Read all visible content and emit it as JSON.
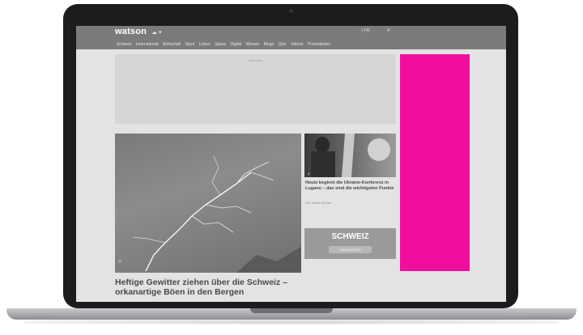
{
  "header": {
    "logo": "watson",
    "weather_icon": "cloud-sun-icon",
    "right_text": "·  |  FR",
    "search_icon": "search-icon"
  },
  "nav": {
    "items": [
      "Schweiz",
      "International",
      "Wirtschaft",
      "Sport",
      "Leben",
      "Spass",
      "Digital",
      "Wissen",
      "Blogs",
      "Quiz",
      "Videos",
      "Promotionen"
    ]
  },
  "ad": {
    "label": "Werbung"
  },
  "main_article": {
    "title": "Heftige Gewitter ziehen über die Schweiz – orkanartige Böen in den Bergen"
  },
  "side_article": {
    "count": "4",
    "title": "Heute beginnt die Ukraine-Konferenz in Lugano – das sind die wichtigsten Punkte",
    "author": "Von Stefan Bühler"
  },
  "schweiz_box": {
    "label": "SCHWEIZ",
    "button": "ABONNIEREN"
  },
  "colors": {
    "pink_ad": "#f10e9f",
    "header": "#7b7b7b"
  }
}
